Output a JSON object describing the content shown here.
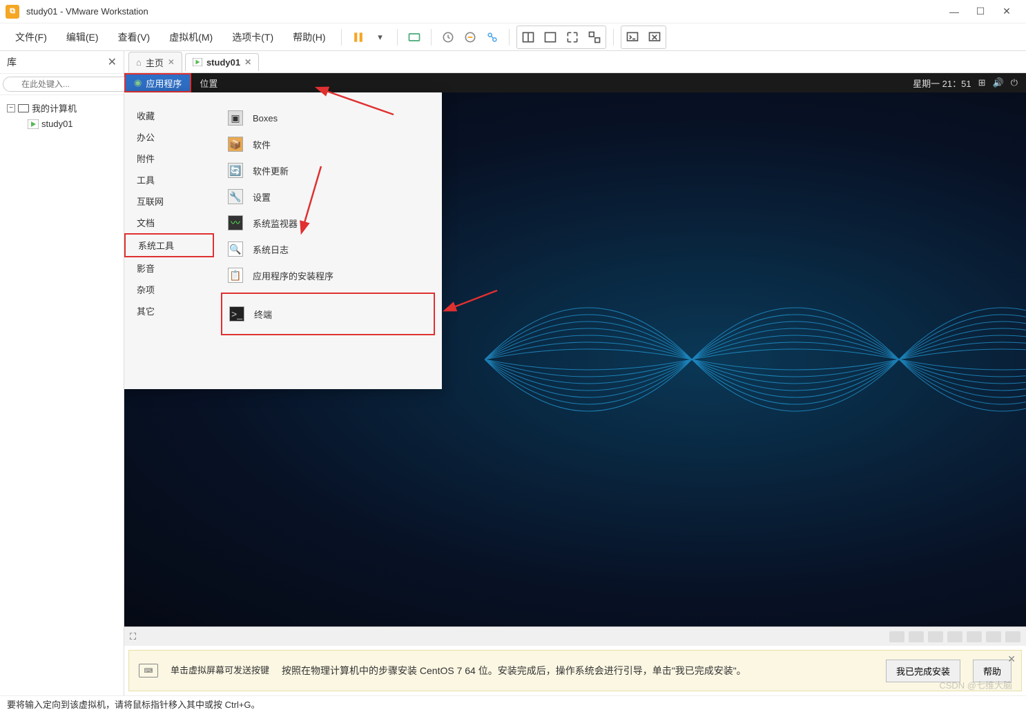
{
  "title": "study01 - VMware Workstation",
  "menubar": {
    "file": "文件(F)",
    "edit": "编辑(E)",
    "view": "查看(V)",
    "vm": "虚拟机(M)",
    "tabs": "选项卡(T)",
    "help": "帮助(H)"
  },
  "sidebar": {
    "header": "库",
    "search_placeholder": "在此处键入...",
    "tree": {
      "root": "我的计算机",
      "child": "study01"
    }
  },
  "tabs": {
    "home": "主页",
    "vm": "study01"
  },
  "gnome": {
    "applications": "应用程序",
    "places": "位置",
    "datetime": "星期一 21：51"
  },
  "app_menu": {
    "categories": {
      "favorites": "收藏",
      "office": "办公",
      "accessories": "附件",
      "tools": "工具",
      "internet": "互联网",
      "documents": "文档",
      "system_tools": "系统工具",
      "multimedia": "影音",
      "misc": "杂项",
      "other": "其它"
    },
    "items": {
      "boxes": "Boxes",
      "software": "软件",
      "software_update": "软件更新",
      "settings": "设置",
      "system_monitor": "系统监视器",
      "system_log": "系统日志",
      "installer": "应用程序的安装程序",
      "terminal": "终端"
    }
  },
  "hint": {
    "keyboard_hint": "单击虚拟屏幕可发送按键",
    "main_hint": "按照在物理计算机中的步骤安装 CentOS 7 64 位。安装完成后，操作系统会进行引导，单击\"我已完成安装\"。",
    "done_btn": "我已完成安装",
    "help_btn": "帮助"
  },
  "statusbar": {
    "text": "要将输入定向到该虚拟机，请将鼠标指针移入其中或按 Ctrl+G。"
  },
  "watermark": "CSDN @七维大脑"
}
